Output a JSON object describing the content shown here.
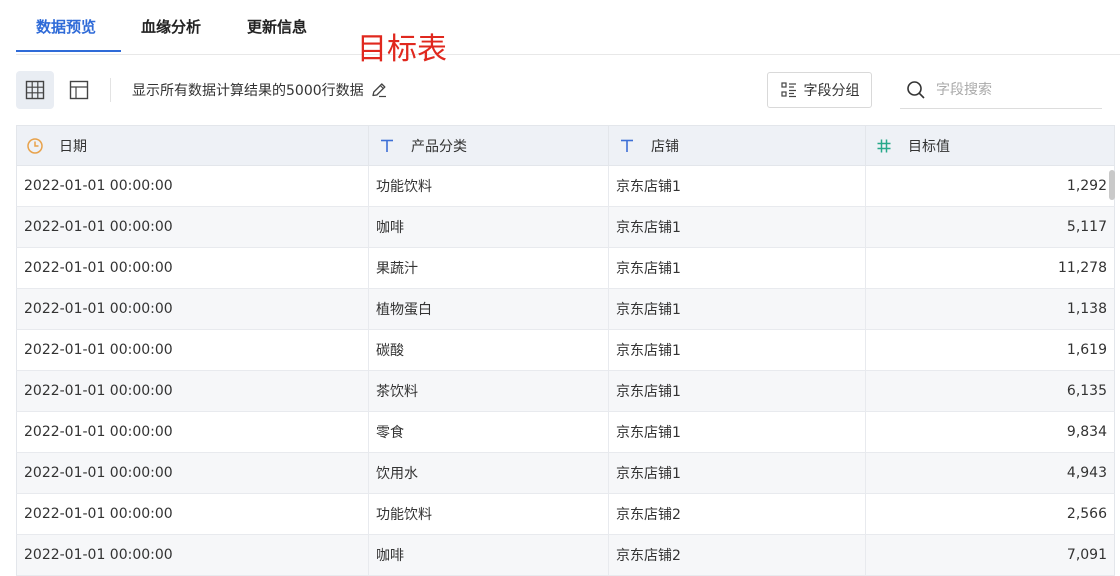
{
  "tabs": [
    {
      "label": "数据预览",
      "active": true
    },
    {
      "label": "血缘分析",
      "active": false
    },
    {
      "label": "更新信息",
      "active": false
    }
  ],
  "annotation": "目标表",
  "toolbar": {
    "info": "显示所有数据计算结果的5000行数据",
    "group_label": "字段分组",
    "search_placeholder": "字段搜索"
  },
  "columns": [
    {
      "label": "日期",
      "icon": "clock-icon"
    },
    {
      "label": "产品分类",
      "icon": "text-type-icon"
    },
    {
      "label": "店铺",
      "icon": "text-type-icon"
    },
    {
      "label": "目标值",
      "icon": "number-type-icon"
    }
  ],
  "rows": [
    [
      "2022-01-01 00:00:00",
      "功能饮料",
      "京东店铺1",
      "1,292"
    ],
    [
      "2022-01-01 00:00:00",
      "咖啡",
      "京东店铺1",
      "5,117"
    ],
    [
      "2022-01-01 00:00:00",
      "果蔬汁",
      "京东店铺1",
      "11,278"
    ],
    [
      "2022-01-01 00:00:00",
      "植物蛋白",
      "京东店铺1",
      "1,138"
    ],
    [
      "2022-01-01 00:00:00",
      "碳酸",
      "京东店铺1",
      "1,619"
    ],
    [
      "2022-01-01 00:00:00",
      "茶饮料",
      "京东店铺1",
      "6,135"
    ],
    [
      "2022-01-01 00:00:00",
      "零食",
      "京东店铺1",
      "9,834"
    ],
    [
      "2022-01-01 00:00:00",
      "饮用水",
      "京东店铺1",
      "4,943"
    ],
    [
      "2022-01-01 00:00:00",
      "功能饮料",
      "京东店铺2",
      "2,566"
    ],
    [
      "2022-01-01 00:00:00",
      "咖啡",
      "京东店铺2",
      "7,091"
    ]
  ],
  "colors": {
    "accent": "#2f6bd8",
    "annotation": "#e0281e",
    "header_bg": "#eef1f6",
    "clock": "#e8a24b",
    "text_type": "#3d6fd6",
    "number_type": "#27a88a"
  }
}
